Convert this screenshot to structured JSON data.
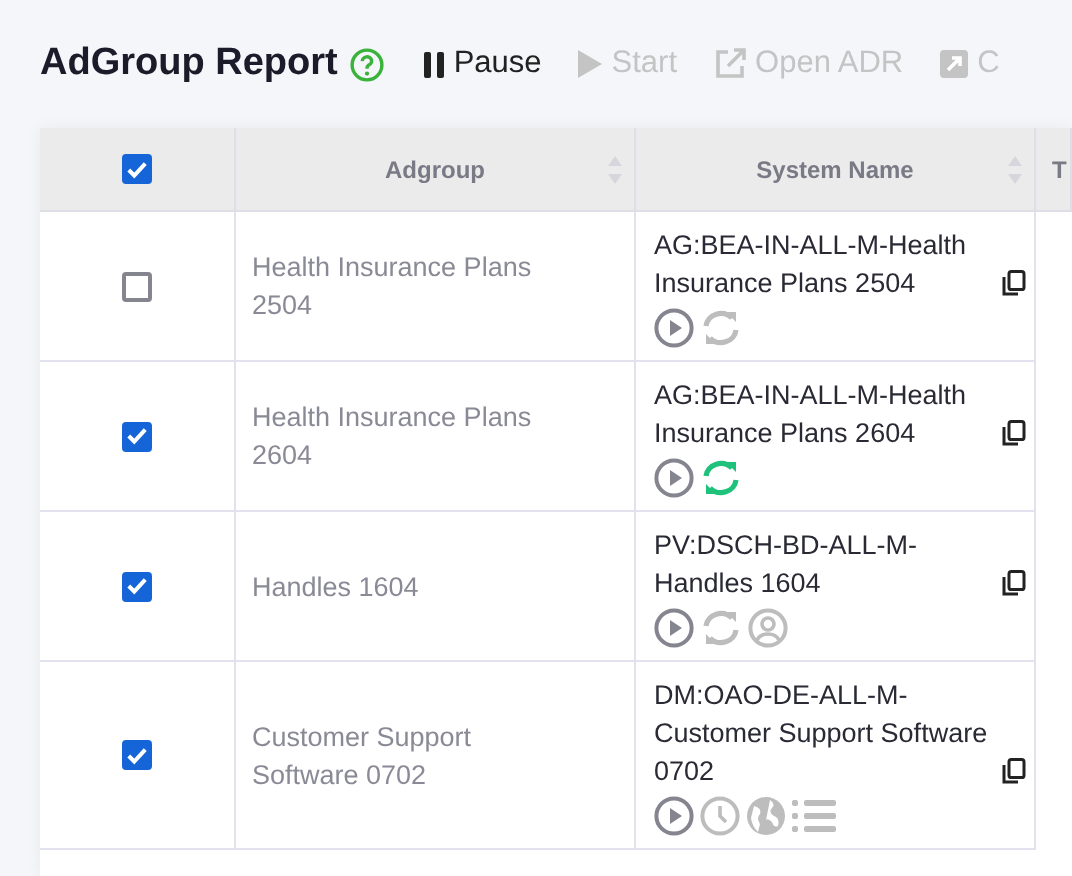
{
  "header": {
    "title": "AdGroup Report",
    "actions": [
      {
        "kind": "pause",
        "label": "Pause",
        "disabled": false
      },
      {
        "kind": "start",
        "label": "Start",
        "disabled": true
      },
      {
        "kind": "open",
        "label": "Open ADR",
        "disabled": true
      },
      {
        "kind": "export",
        "label": "C",
        "disabled": true
      }
    ]
  },
  "table": {
    "all_checked": true,
    "columns": [
      "Adgroup",
      "System Name",
      "T"
    ],
    "rows": [
      {
        "checked": false,
        "adgroup": "Health Insurance Plans 2504",
        "system_name": "AG:BEA-IN-ALL-M-Health Insurance Plans 2504",
        "icons": [
          {
            "kind": "play",
            "active": false
          },
          {
            "kind": "sync",
            "active": false
          }
        ]
      },
      {
        "checked": true,
        "adgroup": "Health Insurance Plans 2604",
        "system_name": "AG:BEA-IN-ALL-M-Health Insurance Plans 2604",
        "icons": [
          {
            "kind": "play",
            "active": false
          },
          {
            "kind": "sync",
            "active": true
          }
        ]
      },
      {
        "checked": true,
        "adgroup": "Handles 1604",
        "system_name": "PV:DSCH-BD-ALL-M-Handles 1604",
        "icons": [
          {
            "kind": "play",
            "active": false
          },
          {
            "kind": "sync",
            "active": false
          },
          {
            "kind": "user",
            "active": false
          }
        ]
      },
      {
        "checked": true,
        "adgroup": "Customer Support Software 0702",
        "system_name": "DM:OAO-DE-ALL-M-Customer Support Software 0702",
        "icons": [
          {
            "kind": "play",
            "active": false
          },
          {
            "kind": "clock",
            "active": false
          },
          {
            "kind": "globe",
            "active": false
          },
          {
            "kind": "list",
            "active": false
          }
        ]
      }
    ]
  }
}
